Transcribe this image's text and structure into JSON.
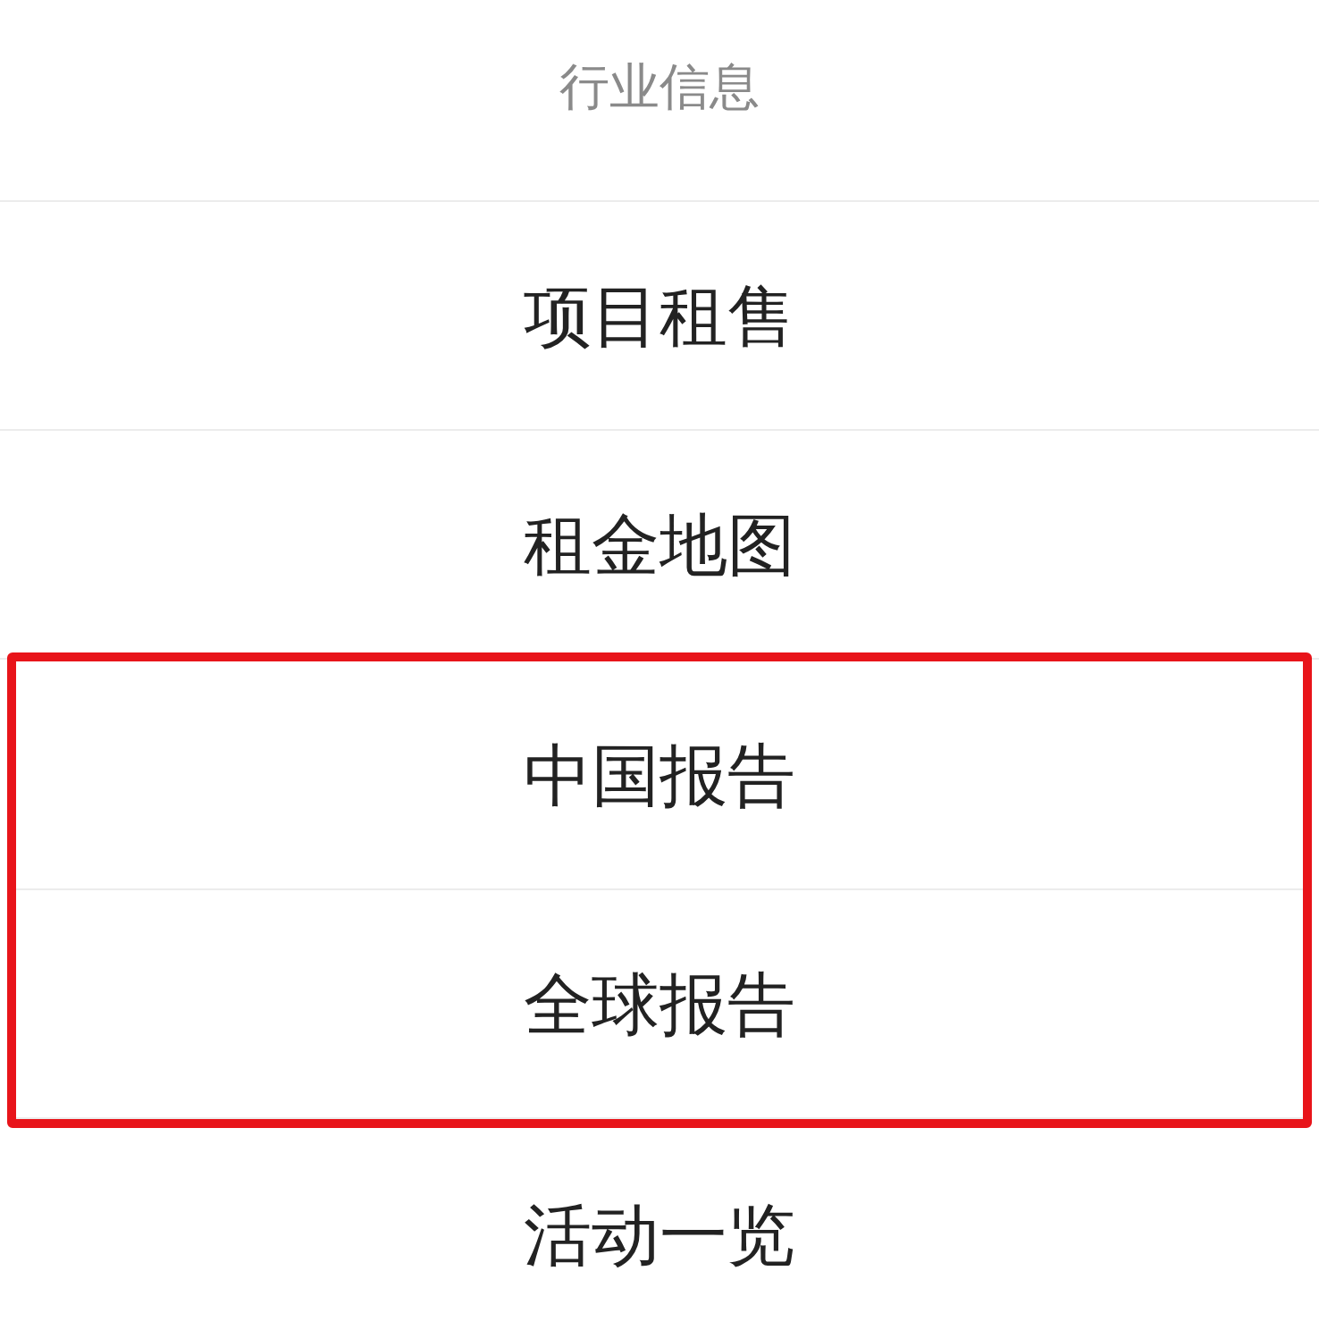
{
  "header": {
    "title": "行业信息"
  },
  "menu_items": [
    {
      "label": "项目租售",
      "highlighted": false
    },
    {
      "label": "租金地图",
      "highlighted": false
    },
    {
      "label": "中国报告",
      "highlighted": true
    },
    {
      "label": "全球报告",
      "highlighted": true
    },
    {
      "label": "活动一览",
      "highlighted": false
    }
  ]
}
